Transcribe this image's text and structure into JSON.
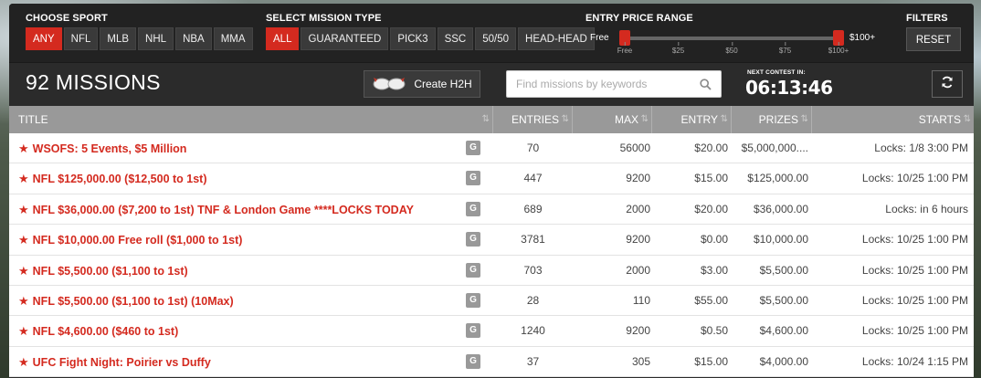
{
  "filters": {
    "sport": {
      "heading": "CHOOSE SPORT",
      "options": [
        "ANY",
        "NFL",
        "MLB",
        "NHL",
        "NBA",
        "MMA"
      ],
      "active": 0
    },
    "mission_type": {
      "heading": "SELECT MISSION TYPE",
      "options": [
        "ALL",
        "GUARANTEED",
        "PICK3",
        "SSC",
        "50/50",
        "HEAD-HEAD"
      ],
      "active": 0
    },
    "price": {
      "heading": "ENTRY PRICE RANGE",
      "min_label": "Free",
      "max_label": "$100+",
      "ticks": [
        "Free",
        "$25",
        "$50",
        "$75",
        "$100+"
      ],
      "range_low": 0,
      "range_high": 1
    },
    "misc": {
      "heading": "FILTERS",
      "reset_label": "RESET"
    }
  },
  "header": {
    "missions_count": "92 MISSIONS",
    "h2h_label": "Create H2H",
    "search_placeholder": "Find missions by keywords",
    "next_contest_label": "NEXT CONTEST IN:",
    "countdown": "06:13:46"
  },
  "table": {
    "columns": {
      "title": "TITLE",
      "entries": "ENTRIES",
      "max": "MAX",
      "entry": "ENTRY",
      "prizes": "PRIZES",
      "starts": "STARTS"
    },
    "badge_label": "G",
    "rows": [
      {
        "title": "WSOFS: 5 Events, $5 Million",
        "entries": "70",
        "max": "56000",
        "entry": "$20.00",
        "prizes": "$5,000,000....",
        "starts": "Locks: 1/8 3:00 PM"
      },
      {
        "title": "NFL $125,000.00 ($12,500 to 1st)",
        "entries": "447",
        "max": "9200",
        "entry": "$15.00",
        "prizes": "$125,000.00",
        "starts": "Locks: 10/25 1:00 PM"
      },
      {
        "title": "NFL $36,000.00 ($7,200 to 1st) TNF & London Game ****LOCKS TODAY",
        "entries": "689",
        "max": "2000",
        "entry": "$20.00",
        "prizes": "$36,000.00",
        "starts": "Locks: in 6 hours"
      },
      {
        "title": "NFL $10,000.00 Free roll ($1,000 to 1st)",
        "entries": "3781",
        "max": "9200",
        "entry": "$0.00",
        "prizes": "$10,000.00",
        "starts": "Locks: 10/25 1:00 PM"
      },
      {
        "title": "NFL $5,500.00 ($1,100 to 1st)",
        "entries": "703",
        "max": "2000",
        "entry": "$3.00",
        "prizes": "$5,500.00",
        "starts": "Locks: 10/25 1:00 PM"
      },
      {
        "title": "NFL $5,500.00 ($1,100 to 1st) (10Max)",
        "entries": "28",
        "max": "110",
        "entry": "$55.00",
        "prizes": "$5,500.00",
        "starts": "Locks: 10/25 1:00 PM"
      },
      {
        "title": "NFL $4,600.00 ($460 to 1st)",
        "entries": "1240",
        "max": "9200",
        "entry": "$0.50",
        "prizes": "$4,600.00",
        "starts": "Locks: 10/25 1:00 PM"
      },
      {
        "title": "UFC Fight Night: Poirier vs Duffy",
        "entries": "37",
        "max": "305",
        "entry": "$15.00",
        "prizes": "$4,000.00",
        "starts": "Locks: 10/24 1:15 PM"
      }
    ]
  },
  "colors": {
    "accent": "#d42a1f",
    "header_bg": "#999999",
    "bar_bg": "#222222"
  },
  "icons": {
    "h2h": "boxing-gloves-icon",
    "search": "magnifier-icon",
    "refresh": "refresh-icon",
    "featured": "star-icon",
    "guaranteed": "g-badge-icon"
  }
}
